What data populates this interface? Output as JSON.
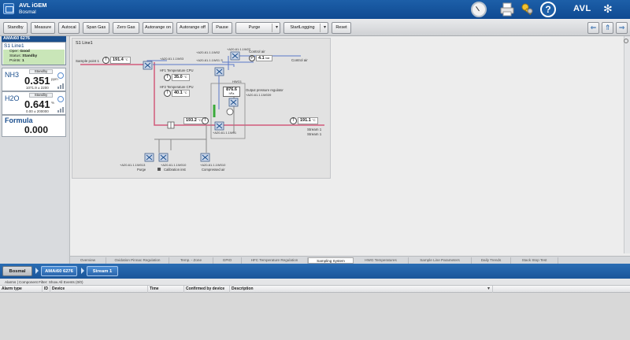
{
  "titlebar": {
    "app_title": "AVL iGEM",
    "subtitle": "Bosmal",
    "brand": "AVL"
  },
  "toolbar": {
    "buttons": [
      {
        "label": "Standby"
      },
      {
        "label": "Measure"
      },
      {
        "label": "Autocal"
      },
      {
        "label": "Span Gas"
      },
      {
        "label": "Zero Gas"
      },
      {
        "label": "Autorange on"
      },
      {
        "label": "Autorange off"
      },
      {
        "label": "Pause"
      },
      {
        "label": "Purge"
      },
      {
        "label": "StartLogging"
      },
      {
        "label": "Reset"
      }
    ]
  },
  "left_panel": {
    "device_header": "AMAi60 6276",
    "line": {
      "name": "S1 Line1",
      "oper_label": "Oper:",
      "oper_value": "Good",
      "status_label": "Status:",
      "status_value": "Standby",
      "points_label": "Points:",
      "points_value": "1"
    },
    "components": [
      {
        "name": "NH3",
        "state": "Standby",
        "value": "0.351",
        "unit": "ppm",
        "range": "1071.9 ± 2200"
      },
      {
        "name": "H2O",
        "state": "Standby",
        "value": "0.641",
        "unit": "%",
        "range": "0.00 ± 200000"
      }
    ],
    "formula": {
      "name": "Formula",
      "value": "0.000"
    }
  },
  "diagram": {
    "title": "S1 Line1",
    "labels": {
      "sample_point": "Sample point 1",
      "temp_sample": "191.4",
      "temp_sample_unit": "°C",
      "valve1_id": "+A20-61.1.1W03",
      "valve2_id": "+A20-61.1.1W02",
      "valve3_id": "+A20-61.1.1W01 S",
      "valve4_id": "+A20-61.1.1W22",
      "control_air": "Control air",
      "pressure": "4.1",
      "pressure_unit": "bar",
      "control_air2": "Control air",
      "hf1_label": "HF1 Temperature CPU",
      "hf1_value": "35.0",
      "hf1_unit": "°C",
      "hf2_label": "HF2 Temperature CPU",
      "hf2_value": "40.1",
      "hf2_unit": "°C",
      "device_label": "HWG1",
      "press_reg_value": "876.6",
      "press_reg_unit": "hPa",
      "press_reg_label": "Output pressure regulator",
      "press_reg_id": "+A20-61.1.1W039",
      "line_temp": "193.2",
      "line_temp_unit": "°C",
      "out_temp": "191.1",
      "out_temp_unit": "°C",
      "stream1": "Stream 1",
      "stream2": "Stream 1",
      "bottom_valve_id": "+A20-61.1.1W01",
      "purge_id": "+A20-61.1.1W013",
      "purge_label": "Purge",
      "cal_id": "+A20-61.1.1W010",
      "cal_label": "Calibration inst",
      "comp_id": "+A20-61.1.1W010",
      "comp_label": "Compressed air"
    }
  },
  "main_tabs": [
    {
      "label": "Overview"
    },
    {
      "label": "Oxidation Pinnac Regulation"
    },
    {
      "label": "Temp. - Zone"
    },
    {
      "label": "GPIO"
    },
    {
      "label": "HFC Temperature Regulation"
    },
    {
      "label": "Sampling System"
    },
    {
      "label": "HWG Temperatures"
    },
    {
      "label": "Sample Line Parameters"
    },
    {
      "label": "Daily Trends"
    },
    {
      "label": "Stack Stop Test"
    }
  ],
  "bottom_bar": {
    "bosmal": "Bosmal",
    "device": "AMAi60 6276",
    "stream": "Stream 1"
  },
  "alarm": {
    "filter": "Alarms | Component Filter: Show All Events (0/0)",
    "columns": [
      "Alarm type",
      "ID",
      "Device",
      "Time",
      "Confirmed by device",
      "Description"
    ]
  },
  "colors": {
    "title_bg": "#1d5fa8",
    "pipe_red": "#d25a7a",
    "pipe_blue": "#5a78c8",
    "status_green": "#c9e6b8",
    "pipe_green": "#3aaa3a"
  }
}
